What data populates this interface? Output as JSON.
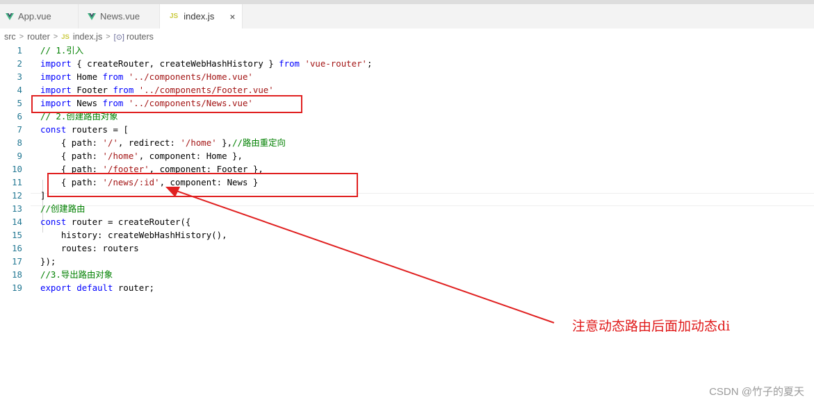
{
  "tabs": [
    {
      "label": "App.vue",
      "icon": "vue-icon"
    },
    {
      "label": "News.vue",
      "icon": "vue-icon"
    },
    {
      "label": "index.js",
      "icon": "js-icon",
      "icon_text": "JS",
      "active": true,
      "close": "×"
    }
  ],
  "breadcrumb": {
    "items": [
      "src",
      "router",
      "index.js",
      "routers"
    ],
    "separator": ">",
    "js_badge": "JS",
    "symbol_icon": "[⊙]"
  },
  "editor": {
    "lines": [
      {
        "n": "1",
        "tokens": [
          {
            "t": "// 1.引入",
            "c": "cm"
          }
        ]
      },
      {
        "n": "2",
        "tokens": [
          {
            "t": "import",
            "c": "kw"
          },
          {
            "t": " { createRouter, createWebHashHistory } ",
            "c": ""
          },
          {
            "t": "from",
            "c": "kw"
          },
          {
            "t": " ",
            "c": ""
          },
          {
            "t": "'vue-router'",
            "c": "str"
          },
          {
            "t": ";",
            "c": ""
          }
        ]
      },
      {
        "n": "3",
        "tokens": [
          {
            "t": "import",
            "c": "kw"
          },
          {
            "t": " Home ",
            "c": ""
          },
          {
            "t": "from",
            "c": "kw"
          },
          {
            "t": " ",
            "c": ""
          },
          {
            "t": "'../components/Home.vue'",
            "c": "str"
          }
        ]
      },
      {
        "n": "4",
        "tokens": [
          {
            "t": "import",
            "c": "kw"
          },
          {
            "t": " Footer ",
            "c": ""
          },
          {
            "t": "from",
            "c": "kw"
          },
          {
            "t": " ",
            "c": ""
          },
          {
            "t": "'../components/Footer.vue'",
            "c": "str"
          }
        ]
      },
      {
        "n": "5",
        "tokens": [
          {
            "t": "import",
            "c": "kw"
          },
          {
            "t": " News ",
            "c": ""
          },
          {
            "t": "from",
            "c": "kw"
          },
          {
            "t": " ",
            "c": ""
          },
          {
            "t": "'../components/News.vue'",
            "c": "str"
          }
        ]
      },
      {
        "n": "6",
        "tokens": [
          {
            "t": "// 2.创建路由对象",
            "c": "cm"
          }
        ]
      },
      {
        "n": "7",
        "tokens": [
          {
            "t": "const",
            "c": "kw"
          },
          {
            "t": " routers = [",
            "c": ""
          }
        ]
      },
      {
        "n": "8",
        "tokens": [
          {
            "t": "    { path: ",
            "c": ""
          },
          {
            "t": "'/'",
            "c": "str"
          },
          {
            "t": ", redirect: ",
            "c": ""
          },
          {
            "t": "'/home'",
            "c": "str"
          },
          {
            "t": " },",
            "c": ""
          },
          {
            "t": "//路由重定向",
            "c": "cm"
          }
        ]
      },
      {
        "n": "9",
        "tokens": [
          {
            "t": "    { path: ",
            "c": ""
          },
          {
            "t": "'/home'",
            "c": "str"
          },
          {
            "t": ", component: Home },",
            "c": ""
          }
        ]
      },
      {
        "n": "10",
        "tokens": [
          {
            "t": "    { path: ",
            "c": ""
          },
          {
            "t": "'/footer'",
            "c": "str"
          },
          {
            "t": ", component: Footer },",
            "c": ""
          }
        ]
      },
      {
        "n": "11",
        "tokens": [
          {
            "t": "    { path: ",
            "c": ""
          },
          {
            "t": "'/news/:id'",
            "c": "str"
          },
          {
            "t": ", component: News }",
            "c": ""
          }
        ]
      },
      {
        "n": "12",
        "tokens": [
          {
            "t": "]",
            "c": ""
          }
        ]
      },
      {
        "n": "13",
        "tokens": [
          {
            "t": "//创建路由",
            "c": "cm"
          }
        ]
      },
      {
        "n": "14",
        "tokens": [
          {
            "t": "const",
            "c": "kw"
          },
          {
            "t": " router = createRouter({",
            "c": ""
          }
        ]
      },
      {
        "n": "15",
        "tokens": [
          {
            "t": "    history: createWebHashHistory(),",
            "c": ""
          }
        ]
      },
      {
        "n": "16",
        "tokens": [
          {
            "t": "    routes: routers",
            "c": ""
          }
        ]
      },
      {
        "n": "17",
        "tokens": [
          {
            "t": "});",
            "c": ""
          }
        ]
      },
      {
        "n": "18",
        "tokens": [
          {
            "t": "//3.导出路由对象",
            "c": "cm"
          }
        ]
      },
      {
        "n": "19",
        "tokens": [
          {
            "t": "export",
            "c": "kw"
          },
          {
            "t": " ",
            "c": ""
          },
          {
            "t": "default",
            "c": "kw"
          },
          {
            "t": " router;",
            "c": ""
          }
        ]
      }
    ]
  },
  "annotation": {
    "text": "注意动态路由后面加动态di",
    "color": "#e01818"
  },
  "watermark": "CSDN @竹子的夏天",
  "colors": {
    "keyword": "#0000ff",
    "string": "#a31515",
    "comment": "#008000",
    "line_number": "#237893",
    "vue_green": "#41b883",
    "js_yellow": "#cbcb41",
    "highlight_red": "#e02020"
  }
}
